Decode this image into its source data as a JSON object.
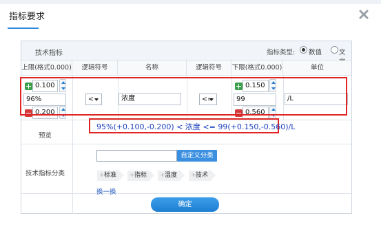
{
  "dialog": {
    "title": "指标要求"
  },
  "panel": {
    "header_label": "技术指标",
    "type_label": "指标类型:",
    "type_options": [
      {
        "label": "数值",
        "selected": true
      },
      {
        "label": "文字",
        "selected": false
      }
    ]
  },
  "columns": {
    "lower_limit": "上限(格式0.000)",
    "logic_left": "逻辑符号",
    "name": "名称",
    "logic_right": "逻辑符号",
    "upper_limit": "下限(格式0.000)",
    "unit": "单位"
  },
  "row": {
    "left_plus_value": "0.100",
    "left_main_value": "96%",
    "left_minus_value": "0.200",
    "left_operator": "<",
    "name_value": "浓度",
    "right_operator": "<=",
    "right_plus_value": "0.150",
    "right_main_value": "99",
    "right_minus_value": "0.560",
    "unit_value": "/L"
  },
  "preview": {
    "label": "预览",
    "text": "95%(+0.100,-0.200) < 浓度 <= 99(+0.150,-0.560)/L"
  },
  "category": {
    "label": "技术指标分类",
    "input_value": "",
    "custom_button": "自定义分类",
    "tags": [
      "标准",
      "指标",
      "温度",
      "技术"
    ],
    "refresh_link": "换一换"
  },
  "confirm_button": "确定",
  "colors": {
    "accent": "#2e8ad8",
    "highlight_border": "#e02424",
    "preview_text": "#1a3fbf",
    "plus": "#3a9e4a",
    "minus": "#d13a3a"
  },
  "icons": {
    "close": "close-icon",
    "plus": "plus-icon",
    "minus": "minus-icon",
    "spinner": "spinner-arrows-icon",
    "dropdown": "chevron-down-icon"
  }
}
